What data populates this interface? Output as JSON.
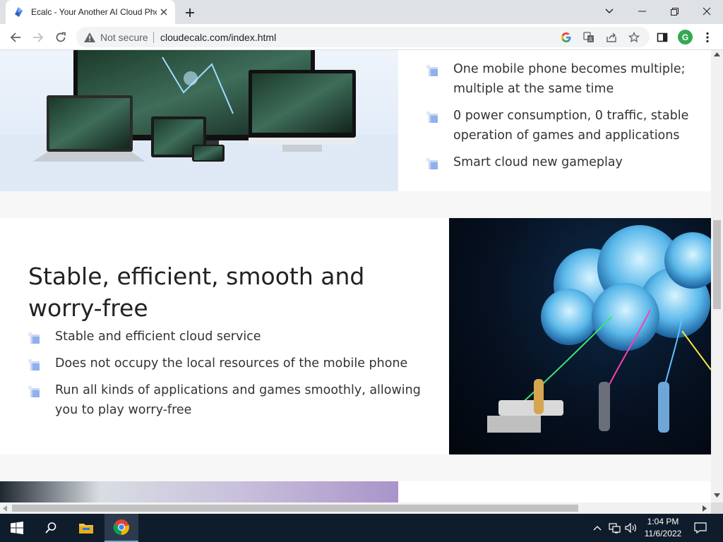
{
  "browser": {
    "tab_title": "Ecalc - Your Another AI Cloud Phone",
    "security_label": "Not secure",
    "url": "cloudecalc.com/index.html",
    "profile_initial": "G"
  },
  "section1": {
    "bullets": [
      "One mobile phone becomes multiple; multiple at the same time",
      "0 power consumption, 0 traffic, stable operation of games and applications",
      "Smart cloud new gameplay"
    ]
  },
  "section2": {
    "title": "Stable, efficient, smooth and worry-free",
    "bullets": [
      "Stable and efficient cloud service",
      "Does not occupy the local resources of the mobile phone",
      "Run all kinds of applications and games smoothly, allowing you to play worry-free"
    ]
  },
  "taskbar": {
    "time": "1:04 PM",
    "date": "11/6/2022"
  },
  "colors": {
    "bullet_icon": "#9fb6e8",
    "tab_strip": "#dee1e6",
    "taskbar": "#0f1c2b"
  }
}
